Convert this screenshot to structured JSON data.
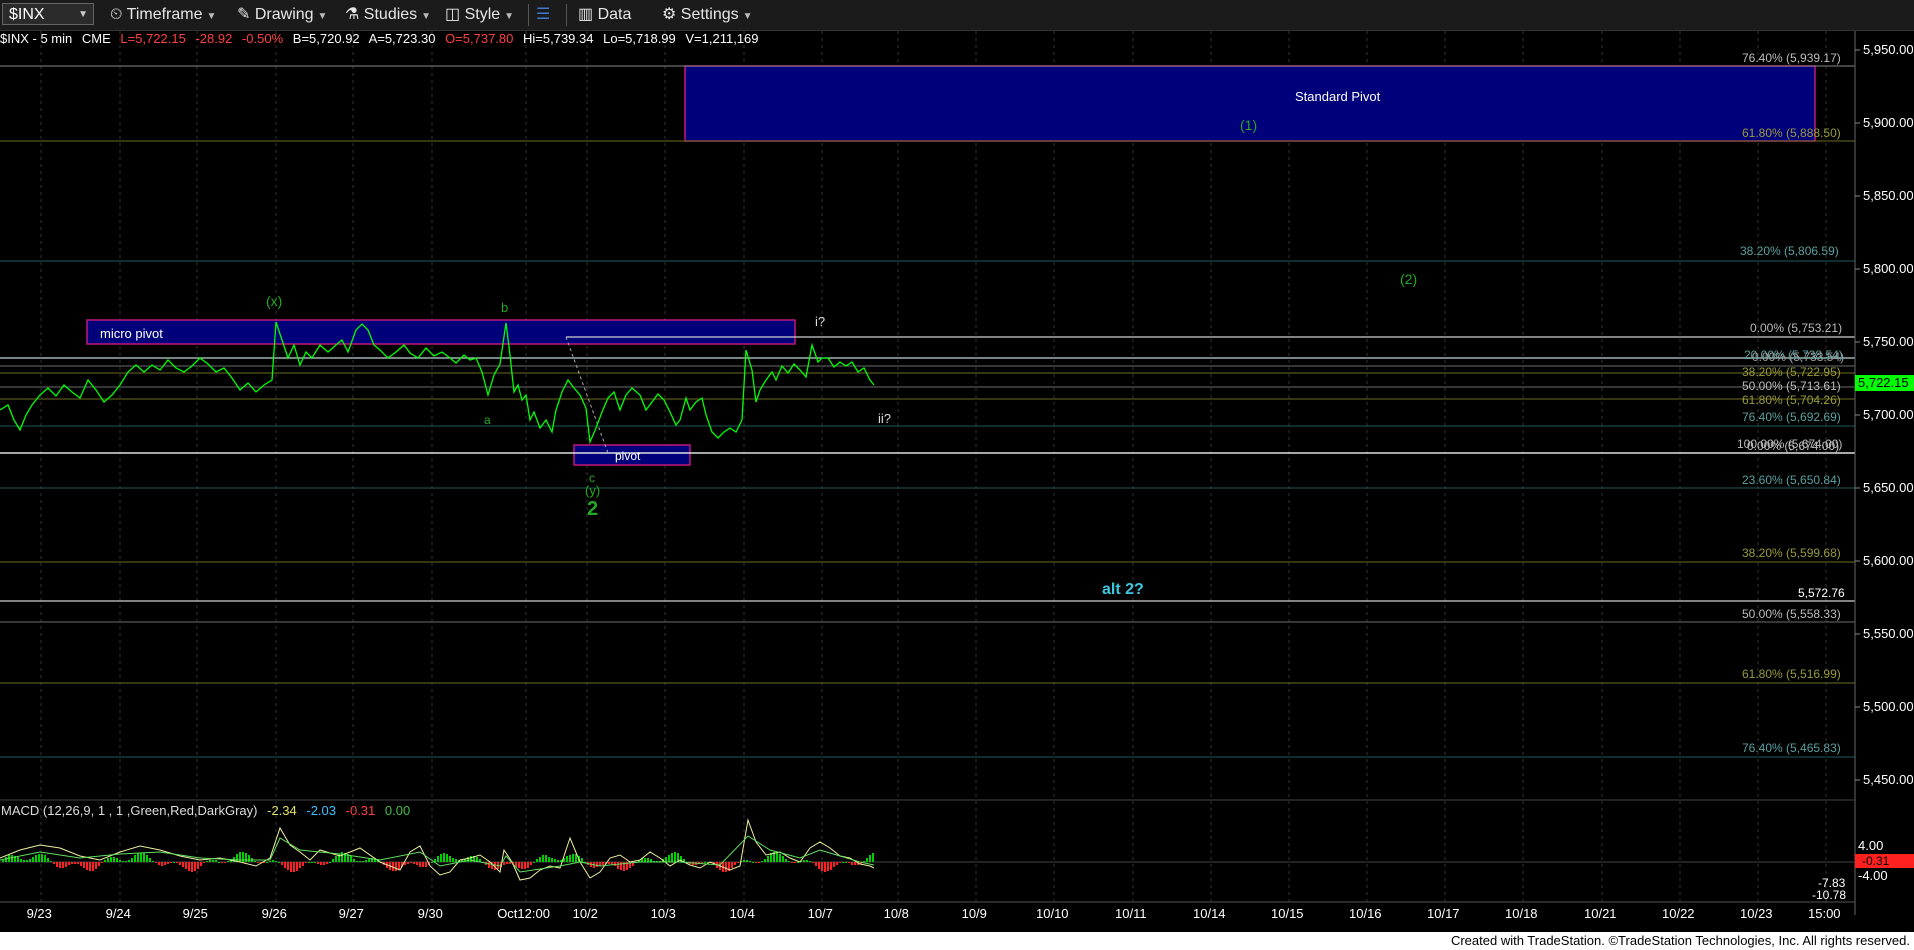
{
  "toolbar": {
    "symbol": "$INX",
    "timeframe": "Timeframe",
    "drawing": "Drawing",
    "studies": "Studies",
    "style": "Style",
    "data": "Data",
    "settings": "Settings"
  },
  "info": {
    "symbol": "$INX - 5 min",
    "exchange": "CME",
    "last": "L=5,722.15",
    "change": "-28.92",
    "pct": "-0.50%",
    "bid": "B=5,720.92",
    "ask": "A=5,723.30",
    "open": "O=5,737.80",
    "hi": "Hi=5,739.34",
    "lo": "Lo=5,718.99",
    "vol": "V=1,211,169"
  },
  "price_axis": {
    "ticks": [
      "5,950.00",
      "5,900.00",
      "5,850.00",
      "5,800.00",
      "5,750.00",
      "5,700.00",
      "5,650.00",
      "5,600.00",
      "5,550.00",
      "5,500.00",
      "5,450.00"
    ],
    "last_price": "5,722.15",
    "last_color": "#00ff00"
  },
  "date_axis": [
    "9/23",
    "9/24",
    "9/25",
    "9/26",
    "9/27",
    "9/30",
    "Oct12:00",
    "10/2",
    "10/3",
    "10/4",
    "10/7",
    "10/8",
    "10/9",
    "10/10",
    "10/11",
    "10/14",
    "10/15",
    "10/16",
    "10/17",
    "10/18",
    "10/21",
    "10/22",
    "10/23",
    "15:00"
  ],
  "fib_labels": [
    {
      "text": "76.40% (5,939.17)",
      "color": "#bcbcbc"
    },
    {
      "text": "61.80% (5,888.50)",
      "color": "#9a9a3a"
    },
    {
      "text": "38.20% (5,806.59)",
      "color": "#5aa0a0"
    },
    {
      "text": "0.00% (5,753.21)",
      "color": "#bcbcbc"
    },
    {
      "text": "20.00% (5,738.54)",
      "color": "#5aa0a0"
    },
    {
      "text": "0.00% (5,733.54)",
      "color": "#9a9a9a"
    },
    {
      "text": "38.20% (5,722.95)",
      "color": "#9a9a3a"
    },
    {
      "text": "50.00% (5,713.61)",
      "color": "#bcbcbc"
    },
    {
      "text": "61.80% (5,704.26)",
      "color": "#9a9a3a"
    },
    {
      "text": "76.40% (5,692.69)",
      "color": "#5aa0a0"
    },
    {
      "text": "100.00% (5,674.00)",
      "color": "#bcbcbc"
    },
    {
      "text": "0.00% (5,674.00)",
      "color": "#bcbcbc"
    },
    {
      "text": "23.60% (5,650.84)",
      "color": "#5aa0a0"
    },
    {
      "text": "38.20% (5,599.68)",
      "color": "#9a9a3a"
    },
    {
      "text": "5,572.76",
      "color": "#ffffff"
    },
    {
      "text": "50.00% (5,558.33)",
      "color": "#bcbcbc"
    },
    {
      "text": "61.80% (5,516.99)",
      "color": "#9a9a3a"
    },
    {
      "text": "76.40% (5,465.83)",
      "color": "#5aa0a0"
    }
  ],
  "annotations": {
    "standard_pivot": "Standard Pivot",
    "micro_pivot": "micro pivot",
    "pivot": "pivot",
    "wave_1": "(1)",
    "wave_2": "(2)",
    "wave_x": "(x)",
    "wave_y": "(y)",
    "wave_b": "b",
    "wave_a": "a",
    "wave_c": "c",
    "wave_2_big": "2",
    "wave_i": "i?",
    "wave_ii": "ii?",
    "alt_2": "alt 2?"
  },
  "macd": {
    "title": "MACD (12,26,9, 1 , 1 ,Green,Red,DarkGray)",
    "v1": "-2.34",
    "v2": "-2.03",
    "v3": "-0.31",
    "v4": "0.00",
    "axis": [
      "4.00",
      "-0.31",
      "-4.00",
      "-7.83",
      "-10.78"
    ]
  },
  "footer": "Created with TradeStation. ©TradeStation Technologies, Inc. All rights reserved.",
  "colors": {
    "price_line": "#00ff00",
    "down": "#ff3030",
    "zone_blue": "#00007a",
    "zone_border": "#c0187a",
    "wave_green": "#22aa22",
    "alt_cyan": "#3cc8e0"
  }
}
